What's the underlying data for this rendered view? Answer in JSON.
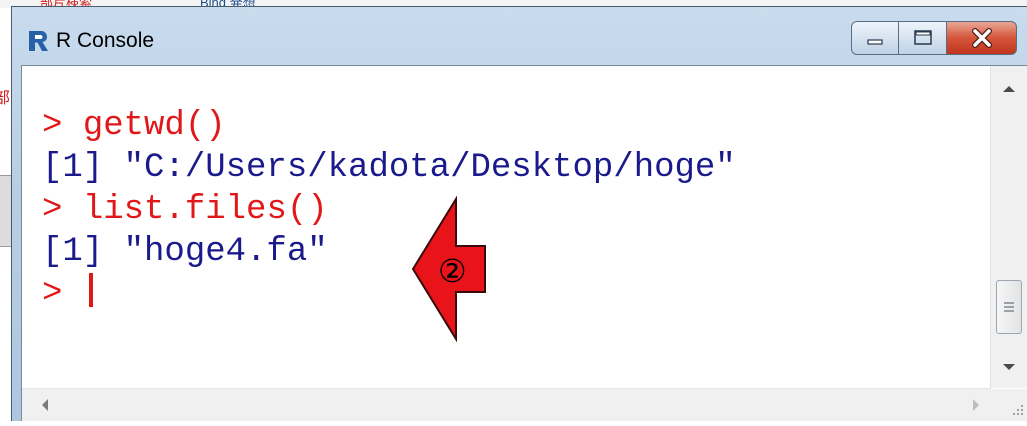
{
  "background": {
    "top_text": "部片検索",
    "top_text2": "Bing 発想",
    "side_mark": "部"
  },
  "window": {
    "title": "R Console",
    "icon": "r-logo-icon",
    "buttons": {
      "minimize": "minimize-icon",
      "maximize": "maximize-icon",
      "close": "close-icon"
    }
  },
  "console": {
    "lines": [
      {
        "prompt": "> ",
        "text": "getwd()",
        "type": "input"
      },
      {
        "prompt": "",
        "text": "[1] \"C:/Users/kadota/Desktop/hoge\"",
        "type": "output"
      },
      {
        "prompt": "> ",
        "text": "list.files()",
        "type": "input"
      },
      {
        "prompt": "",
        "text": "[1] \"hoge4.fa\"",
        "type": "output"
      },
      {
        "prompt": "> ",
        "text": "",
        "type": "input"
      }
    ]
  },
  "annotation": {
    "label": "②",
    "arrow_color": "#e8141a",
    "icon": "left-arrow-icon"
  },
  "colors": {
    "input": "#e0181a",
    "output": "#1a1a8c",
    "close_button": "#c8442a"
  }
}
